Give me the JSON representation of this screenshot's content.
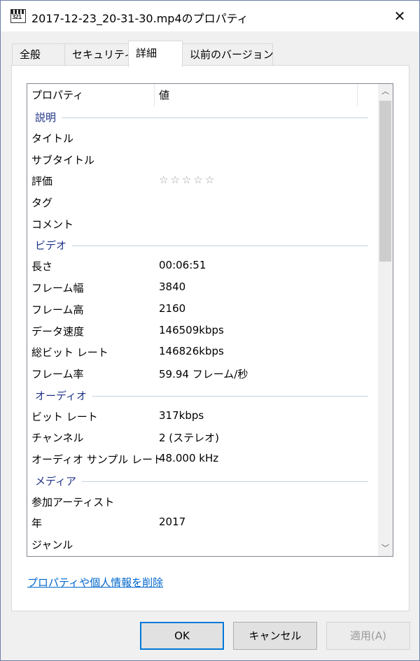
{
  "window": {
    "title": "2017-12-23_20-31-30.mp4のプロパティ",
    "close_glyph": "✕",
    "app_icon_text": "321"
  },
  "tabs": [
    {
      "label": "全般"
    },
    {
      "label": "セキュリティ"
    },
    {
      "label": "詳細"
    },
    {
      "label": "以前のバージョン"
    }
  ],
  "active_tab": "詳細",
  "list": {
    "columns": {
      "property": "プロパティ",
      "value": "値"
    },
    "groups": [
      {
        "name": "説明",
        "rows": [
          {
            "key": "タイトル",
            "value": ""
          },
          {
            "key": "サブタイトル",
            "value": ""
          },
          {
            "key": "評価",
            "value": "☆☆☆☆☆",
            "rating_stars": 0
          },
          {
            "key": "タグ",
            "value": ""
          },
          {
            "key": "コメント",
            "value": ""
          }
        ]
      },
      {
        "name": "ビデオ",
        "rows": [
          {
            "key": "長さ",
            "value": "00:06:51"
          },
          {
            "key": "フレーム幅",
            "value": "3840"
          },
          {
            "key": "フレーム高",
            "value": "2160"
          },
          {
            "key": "データ速度",
            "value": "146509kbps"
          },
          {
            "key": "総ビット レート",
            "value": "146826kbps"
          },
          {
            "key": "フレーム率",
            "value": "59.94 フレーム/秒"
          }
        ]
      },
      {
        "name": "オーディオ",
        "rows": [
          {
            "key": "ビット レート",
            "value": "317kbps"
          },
          {
            "key": "チャンネル",
            "value": "2 (ステレオ)"
          },
          {
            "key": "オーディオ サンプル レート",
            "value": "48.000 kHz"
          }
        ]
      },
      {
        "name": "メディア",
        "rows": [
          {
            "key": "参加アーティスト",
            "value": ""
          },
          {
            "key": "年",
            "value": "2017"
          },
          {
            "key": "ジャンル",
            "value": ""
          }
        ]
      }
    ],
    "scroll_up_glyph": "︿",
    "scroll_down_glyph": "﹀"
  },
  "remove_link": "プロパティや個人情報を削除",
  "buttons": {
    "ok": "OK",
    "cancel": "キャンセル",
    "apply": "適用(A)"
  },
  "colors": {
    "link": "#0066cc",
    "group_header": "#1e3287",
    "ok_border": "#0078d7",
    "disabled_text": "#9a9a9a"
  }
}
